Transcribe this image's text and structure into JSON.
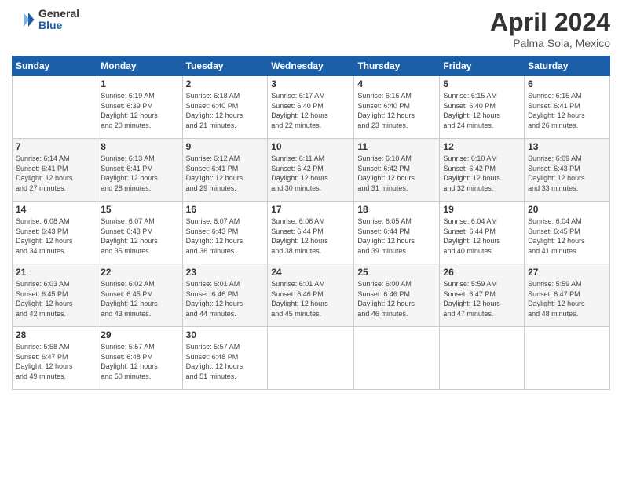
{
  "header": {
    "logo_general": "General",
    "logo_blue": "Blue",
    "month_title": "April 2024",
    "location": "Palma Sola, Mexico"
  },
  "calendar": {
    "days_of_week": [
      "Sunday",
      "Monday",
      "Tuesday",
      "Wednesday",
      "Thursday",
      "Friday",
      "Saturday"
    ],
    "weeks": [
      [
        {
          "day": "",
          "sunrise": "",
          "sunset": "",
          "daylight": ""
        },
        {
          "day": "1",
          "sunrise": "Sunrise: 6:19 AM",
          "sunset": "Sunset: 6:39 PM",
          "daylight": "Daylight: 12 hours and 20 minutes."
        },
        {
          "day": "2",
          "sunrise": "Sunrise: 6:18 AM",
          "sunset": "Sunset: 6:40 PM",
          "daylight": "Daylight: 12 hours and 21 minutes."
        },
        {
          "day": "3",
          "sunrise": "Sunrise: 6:17 AM",
          "sunset": "Sunset: 6:40 PM",
          "daylight": "Daylight: 12 hours and 22 minutes."
        },
        {
          "day": "4",
          "sunrise": "Sunrise: 6:16 AM",
          "sunset": "Sunset: 6:40 PM",
          "daylight": "Daylight: 12 hours and 23 minutes."
        },
        {
          "day": "5",
          "sunrise": "Sunrise: 6:15 AM",
          "sunset": "Sunset: 6:40 PM",
          "daylight": "Daylight: 12 hours and 24 minutes."
        },
        {
          "day": "6",
          "sunrise": "Sunrise: 6:15 AM",
          "sunset": "Sunset: 6:41 PM",
          "daylight": "Daylight: 12 hours and 26 minutes."
        }
      ],
      [
        {
          "day": "7",
          "sunrise": "Sunrise: 6:14 AM",
          "sunset": "Sunset: 6:41 PM",
          "daylight": "Daylight: 12 hours and 27 minutes."
        },
        {
          "day": "8",
          "sunrise": "Sunrise: 6:13 AM",
          "sunset": "Sunset: 6:41 PM",
          "daylight": "Daylight: 12 hours and 28 minutes."
        },
        {
          "day": "9",
          "sunrise": "Sunrise: 6:12 AM",
          "sunset": "Sunset: 6:41 PM",
          "daylight": "Daylight: 12 hours and 29 minutes."
        },
        {
          "day": "10",
          "sunrise": "Sunrise: 6:11 AM",
          "sunset": "Sunset: 6:42 PM",
          "daylight": "Daylight: 12 hours and 30 minutes."
        },
        {
          "day": "11",
          "sunrise": "Sunrise: 6:10 AM",
          "sunset": "Sunset: 6:42 PM",
          "daylight": "Daylight: 12 hours and 31 minutes."
        },
        {
          "day": "12",
          "sunrise": "Sunrise: 6:10 AM",
          "sunset": "Sunset: 6:42 PM",
          "daylight": "Daylight: 12 hours and 32 minutes."
        },
        {
          "day": "13",
          "sunrise": "Sunrise: 6:09 AM",
          "sunset": "Sunset: 6:43 PM",
          "daylight": "Daylight: 12 hours and 33 minutes."
        }
      ],
      [
        {
          "day": "14",
          "sunrise": "Sunrise: 6:08 AM",
          "sunset": "Sunset: 6:43 PM",
          "daylight": "Daylight: 12 hours and 34 minutes."
        },
        {
          "day": "15",
          "sunrise": "Sunrise: 6:07 AM",
          "sunset": "Sunset: 6:43 PM",
          "daylight": "Daylight: 12 hours and 35 minutes."
        },
        {
          "day": "16",
          "sunrise": "Sunrise: 6:07 AM",
          "sunset": "Sunset: 6:43 PM",
          "daylight": "Daylight: 12 hours and 36 minutes."
        },
        {
          "day": "17",
          "sunrise": "Sunrise: 6:06 AM",
          "sunset": "Sunset: 6:44 PM",
          "daylight": "Daylight: 12 hours and 38 minutes."
        },
        {
          "day": "18",
          "sunrise": "Sunrise: 6:05 AM",
          "sunset": "Sunset: 6:44 PM",
          "daylight": "Daylight: 12 hours and 39 minutes."
        },
        {
          "day": "19",
          "sunrise": "Sunrise: 6:04 AM",
          "sunset": "Sunset: 6:44 PM",
          "daylight": "Daylight: 12 hours and 40 minutes."
        },
        {
          "day": "20",
          "sunrise": "Sunrise: 6:04 AM",
          "sunset": "Sunset: 6:45 PM",
          "daylight": "Daylight: 12 hours and 41 minutes."
        }
      ],
      [
        {
          "day": "21",
          "sunrise": "Sunrise: 6:03 AM",
          "sunset": "Sunset: 6:45 PM",
          "daylight": "Daylight: 12 hours and 42 minutes."
        },
        {
          "day": "22",
          "sunrise": "Sunrise: 6:02 AM",
          "sunset": "Sunset: 6:45 PM",
          "daylight": "Daylight: 12 hours and 43 minutes."
        },
        {
          "day": "23",
          "sunrise": "Sunrise: 6:01 AM",
          "sunset": "Sunset: 6:46 PM",
          "daylight": "Daylight: 12 hours and 44 minutes."
        },
        {
          "day": "24",
          "sunrise": "Sunrise: 6:01 AM",
          "sunset": "Sunset: 6:46 PM",
          "daylight": "Daylight: 12 hours and 45 minutes."
        },
        {
          "day": "25",
          "sunrise": "Sunrise: 6:00 AM",
          "sunset": "Sunset: 6:46 PM",
          "daylight": "Daylight: 12 hours and 46 minutes."
        },
        {
          "day": "26",
          "sunrise": "Sunrise: 5:59 AM",
          "sunset": "Sunset: 6:47 PM",
          "daylight": "Daylight: 12 hours and 47 minutes."
        },
        {
          "day": "27",
          "sunrise": "Sunrise: 5:59 AM",
          "sunset": "Sunset: 6:47 PM",
          "daylight": "Daylight: 12 hours and 48 minutes."
        }
      ],
      [
        {
          "day": "28",
          "sunrise": "Sunrise: 5:58 AM",
          "sunset": "Sunset: 6:47 PM",
          "daylight": "Daylight: 12 hours and 49 minutes."
        },
        {
          "day": "29",
          "sunrise": "Sunrise: 5:57 AM",
          "sunset": "Sunset: 6:48 PM",
          "daylight": "Daylight: 12 hours and 50 minutes."
        },
        {
          "day": "30",
          "sunrise": "Sunrise: 5:57 AM",
          "sunset": "Sunset: 6:48 PM",
          "daylight": "Daylight: 12 hours and 51 minutes."
        },
        {
          "day": "",
          "sunrise": "",
          "sunset": "",
          "daylight": ""
        },
        {
          "day": "",
          "sunrise": "",
          "sunset": "",
          "daylight": ""
        },
        {
          "day": "",
          "sunrise": "",
          "sunset": "",
          "daylight": ""
        },
        {
          "day": "",
          "sunrise": "",
          "sunset": "",
          "daylight": ""
        }
      ]
    ]
  }
}
